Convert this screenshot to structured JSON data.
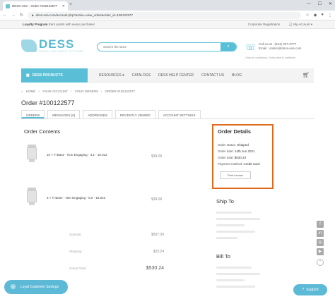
{
  "browser": {
    "tab_title": "DESS USA - Order #100122577",
    "new_tab": "+",
    "window_controls": [
      "—",
      "☐",
      "✕"
    ],
    "url": "dess-usa.com/account.php?action=view_order&order_id=100122577"
  },
  "top_strip": {
    "loyalty_label": "Loyalty Program",
    "loyalty_text": "Earn points with every purchase!",
    "corporate": "Corporate Registration",
    "account": "My Account"
  },
  "header": {
    "logo_word": "DESS",
    "logo_tag": "DENTAL ABUTMENT SYSTEMS",
    "search_placeholder": "Search the store",
    "contact_line1": "Call us at : (844) 337-3777",
    "contact_line2": "Email : orders@dess-usa.com",
    "contact_note": "Order w/ confidence. Every order is confirmed"
  },
  "nav": {
    "products": "DESS PRODUCTS",
    "items": [
      "RESOURCES",
      "CATALOGS",
      "DESS HELP CENTER",
      "CONTACT US",
      "BLOG"
    ]
  },
  "breadcrumb": [
    "HOME",
    "YOUR ACCOUNT",
    "YOUR ORDERS",
    "ORDER #100122577"
  ],
  "page_title": "Order #100122577",
  "account_tabs": [
    "ORDERS",
    "MESSAGES (0)",
    "ADDRESSES",
    "RECENTLY VIEWED",
    "ACCOUNT SETTINGS"
  ],
  "order_contents": {
    "title": "Order Contents",
    "items": [
      {
        "name": "10 × Ti Base - Non Engaging - 4.1 - 15.012",
        "price": "$39.00"
      },
      {
        "name": "3 × Ti Base - Non Engaging - 5.0 - 15.023",
        "price": "$39.00"
      }
    ],
    "subtotal_label": "Subtotal",
    "subtotal": "$507.00",
    "shipping_label": "Shipping",
    "shipping": "$23.24",
    "grand_total_label": "Grand Total",
    "grand_total": "$530.24"
  },
  "order_details": {
    "title": "Order Details",
    "rows": [
      {
        "label": "Order status:",
        "value": "Shipped"
      },
      {
        "label": "Order date:",
        "value": "14th Jun 2021"
      },
      {
        "label": "Order total:",
        "value": "$530.24"
      },
      {
        "label": "Payment method:",
        "value": "Credit Card"
      }
    ],
    "print_button": "Print Invoice"
  },
  "ship_to": "Ship To",
  "bill_to": "Bill To",
  "social": [
    "f",
    "in",
    "◎",
    "▶"
  ],
  "scroll_top": "⌃",
  "savings_button": "Loyal Customer Savings",
  "support_button": "Support",
  "colors": {
    "accent": "#59bfd7",
    "highlight_border": "#e06a1b"
  }
}
